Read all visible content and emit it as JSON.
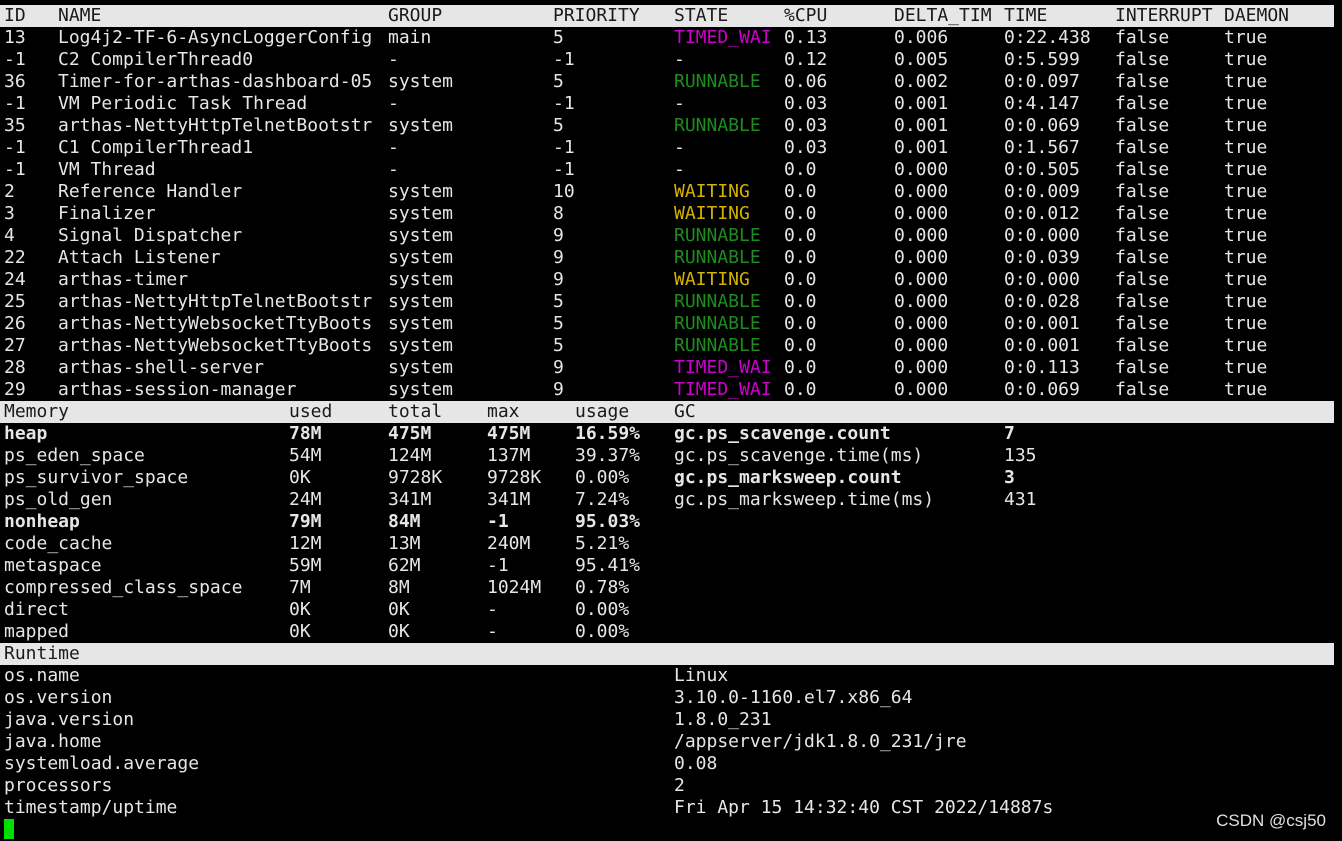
{
  "thread_table": {
    "columns": [
      "ID",
      "NAME",
      "GROUP",
      "PRIORITY",
      "STATE",
      "%CPU",
      "DELTA_TIM",
      "TIME",
      "INTERRUPT",
      "DAEMON"
    ],
    "rows": [
      {
        "id": "13",
        "name": "Log4j2-TF-6-AsyncLoggerConfig",
        "group": "main",
        "priority": "5",
        "state": "TIMED_WAI",
        "state_kind": "timed",
        "cpu": "0.13",
        "delta": "0.006",
        "time": "0:22.438",
        "interrupt": "false",
        "daemon": "true"
      },
      {
        "id": "-1",
        "name": "C2 CompilerThread0",
        "group": "-",
        "priority": "-1",
        "state": "-",
        "state_kind": "none",
        "cpu": "0.12",
        "delta": "0.005",
        "time": "0:5.599",
        "interrupt": "false",
        "daemon": "true"
      },
      {
        "id": "36",
        "name": "Timer-for-arthas-dashboard-05",
        "group": "system",
        "priority": "5",
        "state": "RUNNABLE",
        "state_kind": "run",
        "cpu": "0.06",
        "delta": "0.002",
        "time": "0:0.097",
        "interrupt": "false",
        "daemon": "true"
      },
      {
        "id": "-1",
        "name": "VM Periodic Task Thread",
        "group": "-",
        "priority": "-1",
        "state": "-",
        "state_kind": "none",
        "cpu": "0.03",
        "delta": "0.001",
        "time": "0:4.147",
        "interrupt": "false",
        "daemon": "true"
      },
      {
        "id": "35",
        "name": "arthas-NettyHttpTelnetBootstr",
        "group": "system",
        "priority": "5",
        "state": "RUNNABLE",
        "state_kind": "run",
        "cpu": "0.03",
        "delta": "0.001",
        "time": "0:0.069",
        "interrupt": "false",
        "daemon": "true"
      },
      {
        "id": "-1",
        "name": "C1 CompilerThread1",
        "group": "-",
        "priority": "-1",
        "state": "-",
        "state_kind": "none",
        "cpu": "0.03",
        "delta": "0.001",
        "time": "0:1.567",
        "interrupt": "false",
        "daemon": "true"
      },
      {
        "id": "-1",
        "name": "VM Thread",
        "group": "-",
        "priority": "-1",
        "state": "-",
        "state_kind": "none",
        "cpu": "0.0",
        "delta": "0.000",
        "time": "0:0.505",
        "interrupt": "false",
        "daemon": "true"
      },
      {
        "id": "2",
        "name": "Reference Handler",
        "group": "system",
        "priority": "10",
        "state": "WAITING",
        "state_kind": "wait",
        "cpu": "0.0",
        "delta": "0.000",
        "time": "0:0.009",
        "interrupt": "false",
        "daemon": "true"
      },
      {
        "id": "3",
        "name": "Finalizer",
        "group": "system",
        "priority": "8",
        "state": "WAITING",
        "state_kind": "wait",
        "cpu": "0.0",
        "delta": "0.000",
        "time": "0:0.012",
        "interrupt": "false",
        "daemon": "true"
      },
      {
        "id": "4",
        "name": "Signal Dispatcher",
        "group": "system",
        "priority": "9",
        "state": "RUNNABLE",
        "state_kind": "run",
        "cpu": "0.0",
        "delta": "0.000",
        "time": "0:0.000",
        "interrupt": "false",
        "daemon": "true"
      },
      {
        "id": "22",
        "name": "Attach Listener",
        "group": "system",
        "priority": "9",
        "state": "RUNNABLE",
        "state_kind": "run",
        "cpu": "0.0",
        "delta": "0.000",
        "time": "0:0.039",
        "interrupt": "false",
        "daemon": "true"
      },
      {
        "id": "24",
        "name": "arthas-timer",
        "group": "system",
        "priority": "9",
        "state": "WAITING",
        "state_kind": "wait",
        "cpu": "0.0",
        "delta": "0.000",
        "time": "0:0.000",
        "interrupt": "false",
        "daemon": "true"
      },
      {
        "id": "25",
        "name": "arthas-NettyHttpTelnetBootstr",
        "group": "system",
        "priority": "5",
        "state": "RUNNABLE",
        "state_kind": "run",
        "cpu": "0.0",
        "delta": "0.000",
        "time": "0:0.028",
        "interrupt": "false",
        "daemon": "true"
      },
      {
        "id": "26",
        "name": "arthas-NettyWebsocketTtyBoots",
        "group": "system",
        "priority": "5",
        "state": "RUNNABLE",
        "state_kind": "run",
        "cpu": "0.0",
        "delta": "0.000",
        "time": "0:0.001",
        "interrupt": "false",
        "daemon": "true"
      },
      {
        "id": "27",
        "name": "arthas-NettyWebsocketTtyBoots",
        "group": "system",
        "priority": "5",
        "state": "RUNNABLE",
        "state_kind": "run",
        "cpu": "0.0",
        "delta": "0.000",
        "time": "0:0.001",
        "interrupt": "false",
        "daemon": "true"
      },
      {
        "id": "28",
        "name": "arthas-shell-server",
        "group": "system",
        "priority": "9",
        "state": "TIMED_WAI",
        "state_kind": "timed",
        "cpu": "0.0",
        "delta": "0.000",
        "time": "0:0.113",
        "interrupt": "false",
        "daemon": "true"
      },
      {
        "id": "29",
        "name": "arthas-session-manager",
        "group": "system",
        "priority": "9",
        "state": "TIMED_WAI",
        "state_kind": "timed",
        "cpu": "0.0",
        "delta": "0.000",
        "time": "0:0.069",
        "interrupt": "false",
        "daemon": "true"
      }
    ]
  },
  "memory": {
    "columns": [
      "Memory",
      "used",
      "total",
      "max",
      "usage",
      "GC"
    ],
    "rows": [
      {
        "name": "heap",
        "used": "78M",
        "total": "475M",
        "max": "475M",
        "usage": "16.59%",
        "bold": true
      },
      {
        "name": "ps_eden_space",
        "used": "54M",
        "total": "124M",
        "max": "137M",
        "usage": "39.37%",
        "bold": false
      },
      {
        "name": "ps_survivor_space",
        "used": "0K",
        "total": "9728K",
        "max": "9728K",
        "usage": "0.00%",
        "bold": false
      },
      {
        "name": "ps_old_gen",
        "used": "24M",
        "total": "341M",
        "max": "341M",
        "usage": "7.24%",
        "bold": false
      },
      {
        "name": "nonheap",
        "used": "79M",
        "total": "84M",
        "max": "-1",
        "usage": "95.03%",
        "bold": true
      },
      {
        "name": "code_cache",
        "used": "12M",
        "total": "13M",
        "max": "240M",
        "usage": "5.21%",
        "bold": false
      },
      {
        "name": "metaspace",
        "used": "59M",
        "total": "62M",
        "max": "-1",
        "usage": "95.41%",
        "bold": false
      },
      {
        "name": "compressed_class_space",
        "used": "7M",
        "total": "8M",
        "max": "1024M",
        "usage": "0.78%",
        "bold": false
      },
      {
        "name": "direct",
        "used": "0K",
        "total": "0K",
        "max": "-",
        "usage": "0.00%",
        "bold": false
      },
      {
        "name": "mapped",
        "used": "0K",
        "total": "0K",
        "max": "-",
        "usage": "0.00%",
        "bold": false
      }
    ],
    "gc": [
      {
        "name": "gc.ps_scavenge.count",
        "value": "7",
        "bold": true
      },
      {
        "name": "gc.ps_scavenge.time(ms)",
        "value": "135",
        "bold": false
      },
      {
        "name": "gc.ps_marksweep.count",
        "value": "3",
        "bold": true
      },
      {
        "name": "gc.ps_marksweep.time(ms)",
        "value": "431",
        "bold": false
      }
    ]
  },
  "runtime": {
    "header": "Runtime",
    "rows": [
      {
        "key": "os.name",
        "value": "Linux"
      },
      {
        "key": "os.version",
        "value": "3.10.0-1160.el7.x86_64"
      },
      {
        "key": "java.version",
        "value": "1.8.0_231"
      },
      {
        "key": "java.home",
        "value": "/appserver/jdk1.8.0_231/jre"
      },
      {
        "key": "systemload.average",
        "value": "0.08"
      },
      {
        "key": "processors",
        "value": "2"
      },
      {
        "key": "timestamp/uptime",
        "value": "Fri Apr 15 14:32:40 CST 2022/14887s"
      }
    ]
  },
  "watermark": "CSDN @csj50",
  "colors": {
    "background": "#000000",
    "text": "#e6e6e6",
    "header_bar": "#e6e6e6",
    "timed_waiting": "#cc00cc",
    "runnable": "#1e8c1e",
    "waiting": "#d4b200",
    "cursor": "#00e000"
  }
}
